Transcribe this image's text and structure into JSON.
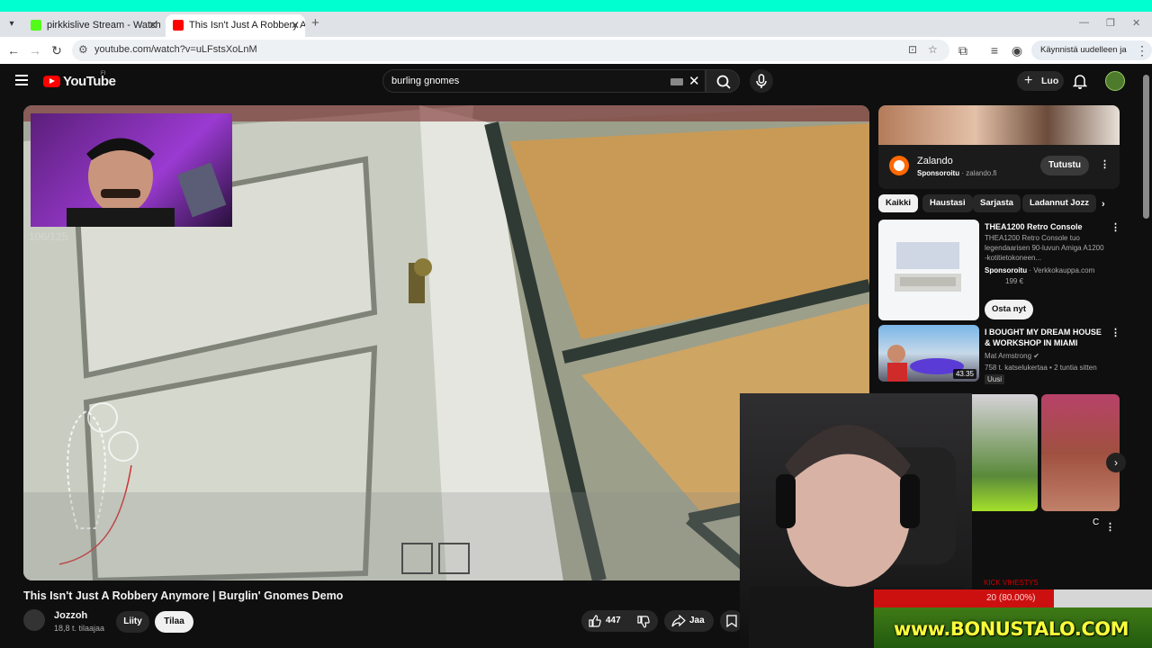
{
  "browser": {
    "tabs": [
      {
        "title": "pirkkislive Stream - Watch Live"
      },
      {
        "title": "This Isn't Just A Robbery Anymo"
      }
    ],
    "url": "youtube.com/watch?v=uLFstsXoLnM",
    "restart_label": "Käynnistä uudelleen ja päivitä"
  },
  "youtube": {
    "logo": "YouTube",
    "country": "FI",
    "search_query": "burling gnomes",
    "create_label": "Luo"
  },
  "player": {
    "overlay_counter": "106/125"
  },
  "video": {
    "title": "This Isn't Just A Robbery Anymore | Burglin' Gnomes Demo",
    "channel": "Jozzoh",
    "subscribers": "18,8 t. tilaajaa",
    "join_label": "Liity",
    "subscribe_label": "Tilaa",
    "likes": "447",
    "share_label": "Jaa"
  },
  "ad": {
    "name": "Zalando",
    "sponsored": "Sponsoroitu",
    "domain": "zalando.fi",
    "cta": "Tutustu"
  },
  "chips": [
    "Kaikki",
    "Haustasi",
    "Sarjasta",
    "Ladannut Jozz"
  ],
  "recommendations": [
    {
      "title": "THEA1200 Retro Console",
      "desc": "THEA1200 Retro Console tuo legendaarisen 90-luvun Amiga A1200 -kotitietokoneen...",
      "sponsored": "Sponsoroitu",
      "seller": "Verkkokauppa.com",
      "price": "199 €",
      "cta": "Osta nyt"
    },
    {
      "title": "I BOUGHT MY DREAM HOUSE & WORKSHOP IN MIAMI",
      "channel": "Mat Armstrong",
      "meta": "758 t. katselukertaa • 2 tuntia sitten",
      "badge": "Uusi",
      "duration": "43.35"
    }
  ],
  "shorts_caption": "C",
  "stream_overlay": {
    "goal_label": "KICK VIHESTYS",
    "goal_progress_text": "20 (80.00%)",
    "goal_fraction": 0.8,
    "banner": "www.BONUSTALO.COM"
  },
  "colors": {
    "accent": "#ff0000",
    "goal_fill": "#cc1010"
  }
}
